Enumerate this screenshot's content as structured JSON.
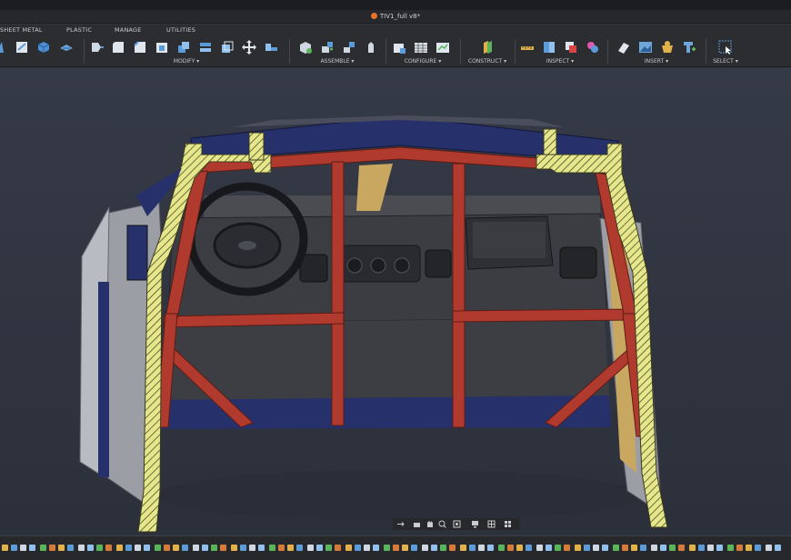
{
  "window": {
    "document_title": "TIV1_full v8*"
  },
  "workspace_tabs": [
    "SHEET METAL",
    "PLASTIC",
    "MANAGE",
    "UTILITIES"
  ],
  "ribbon": {
    "groups": [
      {
        "id": "create",
        "label": ""
      },
      {
        "id": "modify",
        "label": "MODIFY ▾"
      },
      {
        "id": "assemble",
        "label": "ASSEMBLE ▾"
      },
      {
        "id": "configure",
        "label": "CONFIGURE ▾"
      },
      {
        "id": "construct",
        "label": "CONSTRUCT ▾"
      },
      {
        "id": "inspect",
        "label": "INSPECT ▾"
      },
      {
        "id": "insert",
        "label": "INSERT ▾"
      },
      {
        "id": "select",
        "label": "SELECT ▾"
      }
    ]
  },
  "colors": {
    "accent": "#e8742a",
    "cage_red": "#b03a2e",
    "body_blue": "#26306a",
    "section_hatch": "#e6e68a"
  },
  "navbar_icons": [
    "orbit-icon",
    "look-at-icon",
    "pan-icon",
    "zoom-icon",
    "fit-icon",
    "display-settings-icon",
    "grid-icon",
    "viewports-icon"
  ],
  "timeline_icons": [
    "play-start-icon",
    "step-back-icon",
    "play-icon",
    "step-forward-icon",
    "play-end-icon"
  ]
}
